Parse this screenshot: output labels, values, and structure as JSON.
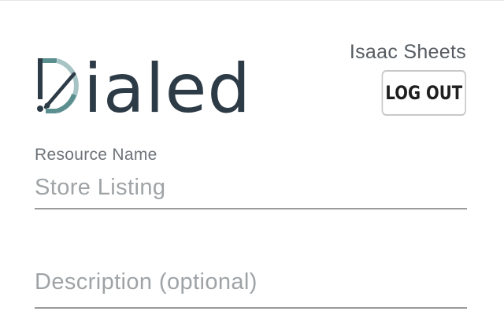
{
  "brand": {
    "name": "ialed",
    "logo_icon": "dial-d-icon",
    "colors": {
      "dark": "#2d3b47",
      "teal": "#5b8e8e",
      "light_teal": "#a7c4c4"
    }
  },
  "header": {
    "user_name": "Isaac Sheets",
    "logout_label": "LOG OUT"
  },
  "form": {
    "resource_name": {
      "label": "Resource Name",
      "value": "",
      "placeholder": "Store Listing"
    },
    "description": {
      "value": "",
      "placeholder": "Description (optional)"
    }
  }
}
